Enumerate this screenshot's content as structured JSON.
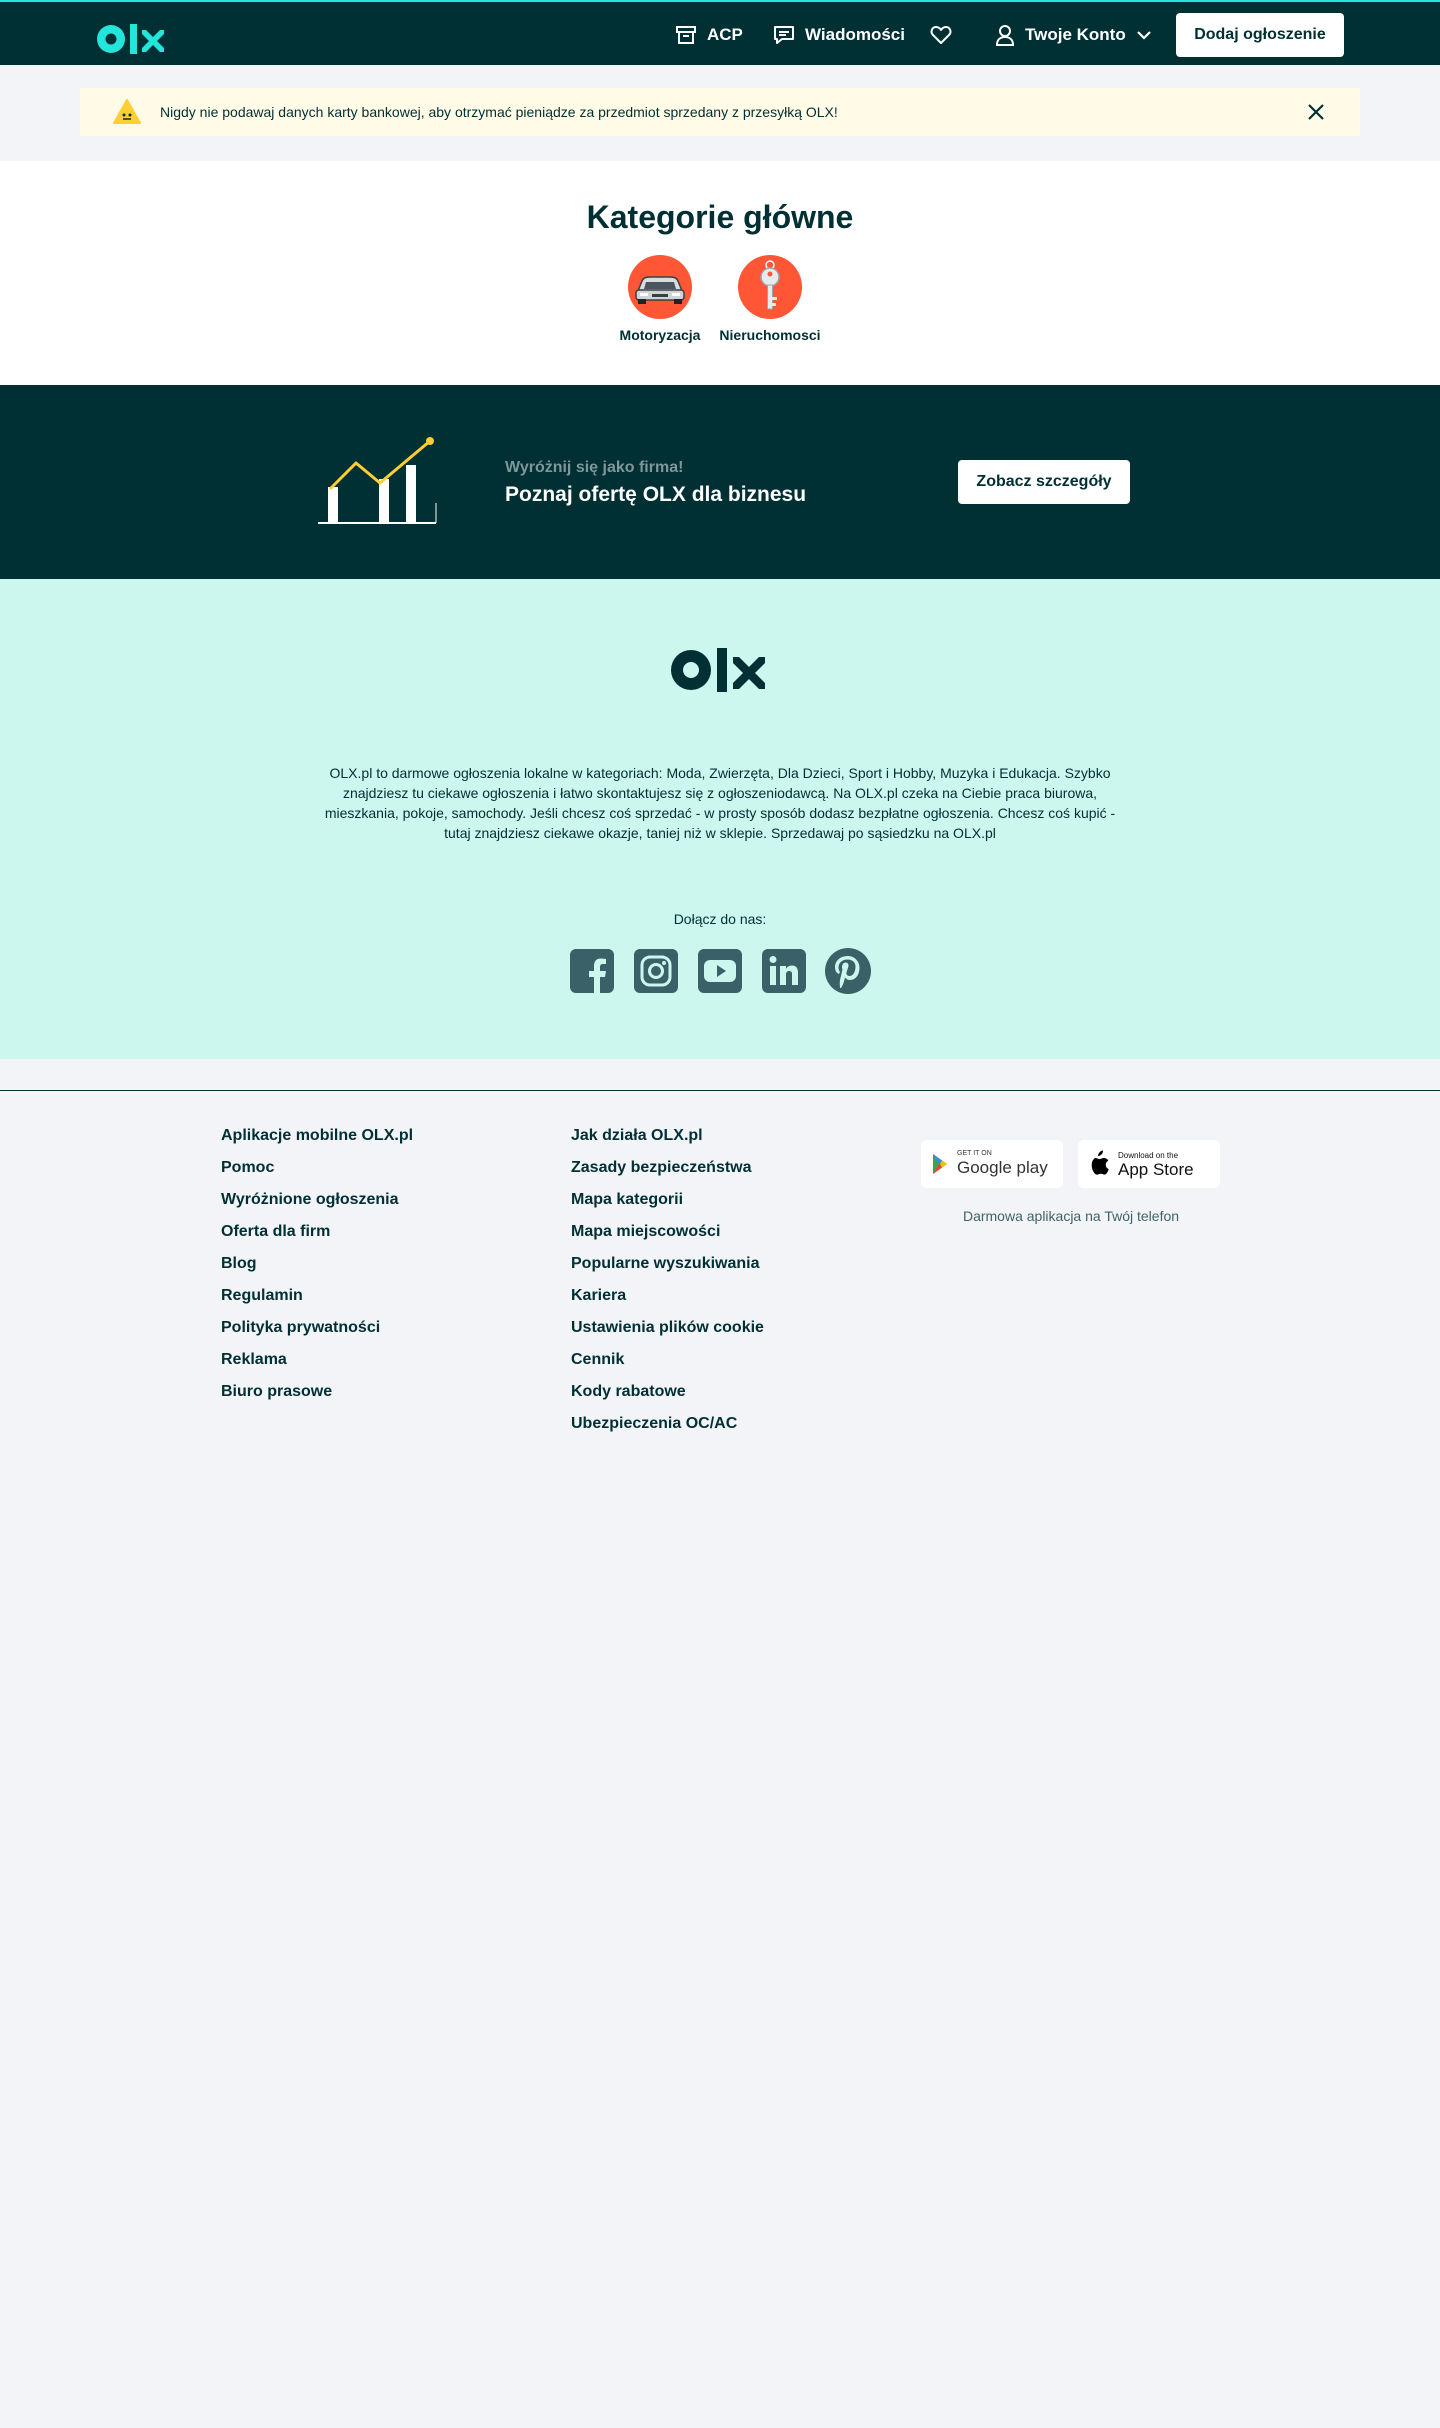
{
  "header": {
    "nav": {
      "acp": "ACP",
      "messages": "Wiadomości",
      "account": "Twoje Konto",
      "icons": [
        "archive-icon",
        "chat-icon",
        "heart-icon",
        "user-icon",
        "chevron-down-icon"
      ]
    },
    "add_button": "Dodaj ogłoszenie"
  },
  "notice": {
    "text": "Nigdy nie podawaj danych karty bankowej, aby otrzymać pieniądze za przedmiot sprzedany z przesyłką OLX!"
  },
  "categories": {
    "title": "Kategorie główne",
    "items": [
      {
        "label": "Motoryzacja",
        "icon": "car-icon"
      },
      {
        "label": "Nieruchomosci",
        "icon": "key-icon"
      }
    ]
  },
  "business": {
    "subtitle": "Wyróżnij się jako firma!",
    "title": "Poznaj ofertę OLX dla biznesu",
    "button": "Zobacz szczegóły"
  },
  "about": {
    "text": "OLX.pl to darmowe ogłoszenia lokalne w kategoriach: Moda, Zwierzęta, Dla Dzieci, Sport i Hobby, Muzyka i Edukacja. Szybko znajdziesz tu ciekawe ogłoszenia i łatwo skontaktujesz się z ogłoszeniodawcą. Na OLX.pl czeka na Ciebie praca biurowa, mieszkania, pokoje, samochody. Jeśli chcesz coś sprzedać - w prosty sposób dodasz bezpłatne ogłoszenia. Chcesz coś kupić - tutaj znajdziesz ciekawe okazje, taniej niż w sklepie. Sprzedawaj po sąsiedzku na OLX.pl",
    "join_label": "Dołącz do nas:",
    "social": [
      "facebook-icon",
      "instagram-icon",
      "youtube-icon",
      "linkedin-icon",
      "pinterest-icon"
    ]
  },
  "footer": {
    "links_col1": [
      "Aplikacje mobilne OLX.pl",
      "Pomoc",
      "Wyróżnione ogłoszenia",
      "Oferta dla firm",
      "Blog",
      "Regulamin",
      "Polityka prywatności",
      "Reklama",
      "Biuro prasowe"
    ],
    "links_col2": [
      "Jak działa OLX.pl",
      "Zasady bezpieczeństwa",
      "Mapa kategorii",
      "Mapa miejscowości",
      "Popularne wyszukiwania",
      "Kariera",
      "Ustawienia plików cookie",
      "Cennik",
      "Kody rabatowe",
      "Ubezpieczenia OC/AC"
    ],
    "google_play": {
      "small": "GET IT ON",
      "big": "Google play"
    },
    "app_store": {
      "small": "Download on the",
      "big": "App Store"
    },
    "store_tagline": "Darmowa aplikacja na Twój telefon"
  },
  "colors": {
    "dark": "#002f34",
    "accent": "#23e5db",
    "mint": "#cbf7ee",
    "notice": "#fffbe6",
    "category": "#ff5636"
  }
}
